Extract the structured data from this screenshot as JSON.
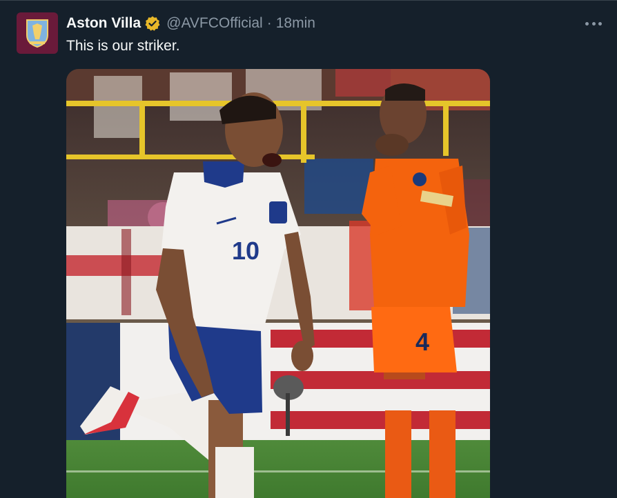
{
  "tweet": {
    "display_name": "Aston Villa",
    "handle": "@AVFCOfficial",
    "separator": "·",
    "time": "18min",
    "text": "This is our striker.",
    "verified_icon": "verified-badge-icon",
    "more_icon": "more-options-icon"
  },
  "media": {
    "description_icon": "photo",
    "player_left_number": "10",
    "player_right_number": "4"
  },
  "colors": {
    "background": "#15202b",
    "text_primary": "#f7f9f9",
    "text_secondary": "#8b98a5",
    "verified_gold": "#e8b829",
    "avatar_bg": "#6a1a3a"
  }
}
